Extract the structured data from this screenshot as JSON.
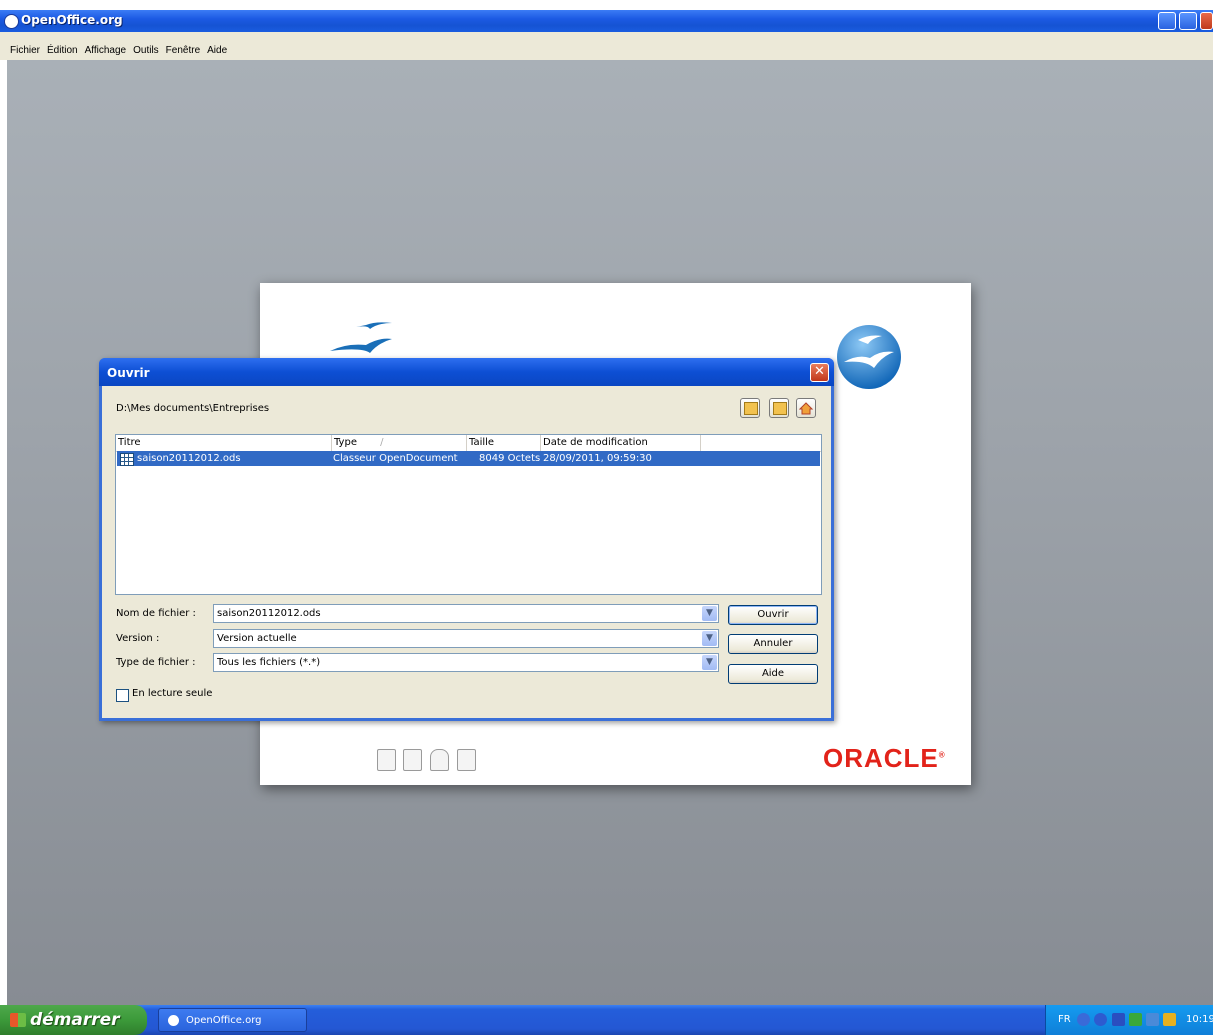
{
  "window": {
    "title": "OpenOffice.org"
  },
  "menu": [
    "Fichier",
    "Édition",
    "Affichage",
    "Outils",
    "Fenêtre",
    "Aide"
  ],
  "splash": {
    "brand": "ORACLE",
    "brand_mark": "®"
  },
  "dialog": {
    "title": "Ouvrir",
    "close_glyph": "✕",
    "path": "D:\\Mes documents\\Entreprises",
    "columns": {
      "title": "Titre",
      "type": "Type",
      "type_sort": "/",
      "size": "Taille",
      "date": "Date de modification"
    },
    "files": [
      {
        "name": "saison20112012.ods",
        "type": "Classeur OpenDocument",
        "size": "8049 Octets",
        "date": "28/09/2011, 09:59:30"
      }
    ],
    "fields": {
      "filename_label": "Nom de fichier :",
      "filename_value": "saison20112012.ods",
      "version_label": "Version :",
      "version_value": "Version actuelle",
      "filetype_label": "Type de fichier :",
      "filetype_value": "Tous les fichiers (*.*)"
    },
    "buttons": {
      "open": "Ouvrir",
      "cancel": "Annuler",
      "help": "Aide"
    },
    "readonly_label": "En lecture seule"
  },
  "taskbar": {
    "start_label": "démarrer",
    "task_label": "OpenOffice.org",
    "lang": "FR",
    "clock": "10:19"
  },
  "colors": {
    "selection": "#316ac5",
    "oracle_red": "#e2231a",
    "titlebar_blue": "#0a46c2"
  }
}
